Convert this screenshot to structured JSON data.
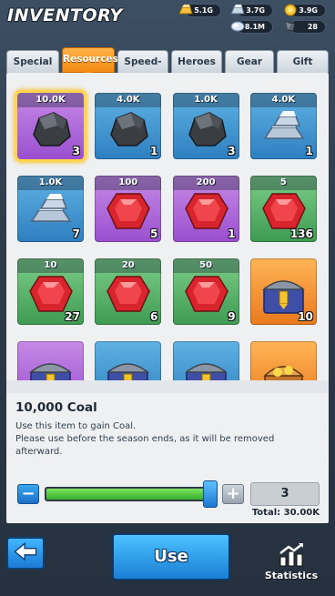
{
  "header": {
    "title": "INVENTORY",
    "resources": [
      {
        "icon": "gold-bar-icon",
        "value": "5.1G"
      },
      {
        "icon": "iron-bar-icon",
        "value": "3.7G"
      },
      {
        "icon": "gold-coin-icon",
        "value": "3.9G"
      },
      {
        "icon": "crystal-icon",
        "value": "8.1M"
      },
      {
        "icon": "gem-shard-icon",
        "value": "28"
      }
    ]
  },
  "tabs": [
    {
      "label": "Special",
      "active": false
    },
    {
      "label": "Resources",
      "active": true
    },
    {
      "label": "Speed-up",
      "active": false
    },
    {
      "label": "Heroes",
      "active": false
    },
    {
      "label": "Gear",
      "active": false
    },
    {
      "label": "Gift",
      "active": false
    }
  ],
  "items": [
    {
      "kind": "coal",
      "rarity": "purple",
      "top": "10.0K",
      "count": "3",
      "selected": true
    },
    {
      "kind": "coal",
      "rarity": "blue",
      "top": "4.0K",
      "count": "1"
    },
    {
      "kind": "coal",
      "rarity": "blue",
      "top": "1.0K",
      "count": "3"
    },
    {
      "kind": "iron",
      "rarity": "blue",
      "top": "4.0K",
      "count": "1"
    },
    {
      "kind": "iron",
      "rarity": "blue",
      "top": "1.0K",
      "count": "7"
    },
    {
      "kind": "ruby",
      "rarity": "purple",
      "top": "100",
      "count": "5"
    },
    {
      "kind": "ruby",
      "rarity": "purple",
      "top": "200",
      "count": "1"
    },
    {
      "kind": "ruby",
      "rarity": "green",
      "top": "5",
      "count": "136"
    },
    {
      "kind": "ruby",
      "rarity": "green",
      "top": "10",
      "count": "27"
    },
    {
      "kind": "ruby",
      "rarity": "green",
      "top": "20",
      "count": "6"
    },
    {
      "kind": "ruby",
      "rarity": "green",
      "top": "50",
      "count": "9"
    },
    {
      "kind": "chest",
      "rarity": "orange",
      "top": "",
      "count": "10"
    },
    {
      "kind": "chest",
      "rarity": "purple",
      "top": "",
      "count": ""
    },
    {
      "kind": "chest",
      "rarity": "blue",
      "top": "",
      "count": ""
    },
    {
      "kind": "chest",
      "rarity": "blue",
      "top": "",
      "count": ""
    },
    {
      "kind": "treasure",
      "rarity": "orange",
      "top": "",
      "count": ""
    }
  ],
  "detail": {
    "name": "10,000 Coal",
    "description": "Use this item to gain Coal.\nPlease use before the season ends, as it will be removed afterward."
  },
  "quantity": {
    "minus_label": "−",
    "plus_label": "+",
    "value": "3",
    "max": 3,
    "fraction": 1.0,
    "total": "Total: 30.00K"
  },
  "bottom": {
    "back_icon": "back-arrow-icon",
    "use_label": "Use",
    "stats_label": "Statistics",
    "stats_icon": "bar-chart-icon"
  },
  "colors": {
    "accent_orange": "#f28a12",
    "button_blue": "#1c7ad4",
    "slider_green": "#34b02a"
  }
}
